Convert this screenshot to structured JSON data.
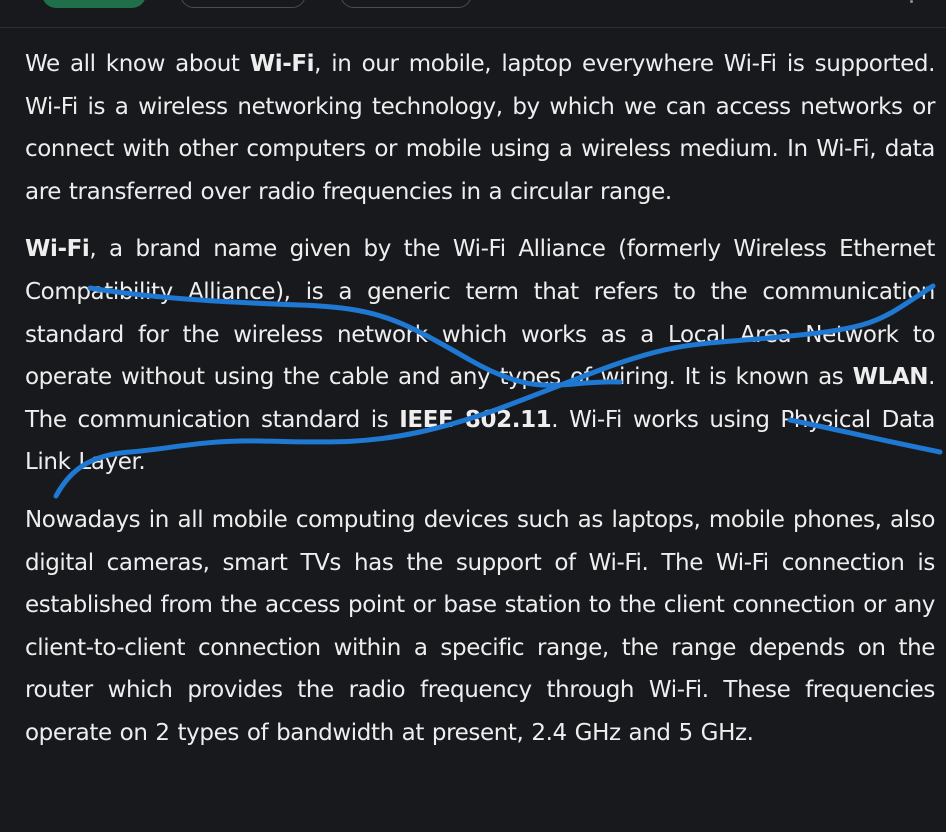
{
  "ink_color": "#1f78d1",
  "paragraphs": [
    {
      "parts": [
        {
          "text": "We all know about ",
          "bold": false
        },
        {
          "text": "Wi-Fi",
          "bold": true
        },
        {
          "text": ", in our mobile, laptop everywhere Wi-Fi is supported. Wi-Fi is a wireless networking technology, by which we can access networks or connect with other computers or mobile using a wireless medium. In Wi-Fi, data are transferred over radio frequencies in a circular range.",
          "bold": false
        }
      ]
    },
    {
      "crossed_out": true,
      "parts": [
        {
          "text": "Wi-Fi",
          "bold": true
        },
        {
          "text": ", a brand name given by the Wi-Fi Alliance (formerly Wireless Ethernet Compatibility Alliance), is a generic term that refers to the communication standard for the wireless network which works as a Local Area Network to operate without using the cable and any types of wiring. It is known as ",
          "bold": false
        },
        {
          "text": "WLAN",
          "bold": true
        },
        {
          "text": ". The communication standard is ",
          "bold": false
        },
        {
          "text": "IEEE 802.11",
          "bold": true
        },
        {
          "text": ". Wi-Fi works using Physical Data Link Layer.",
          "bold": false
        }
      ]
    },
    {
      "parts": [
        {
          "text": "Nowadays in all mobile computing devices such as laptops, mobile phones, also digital cameras, smart TVs has the support of Wi-Fi. The Wi-Fi connection is established from the access point or base station to the client connection or any client-to-client connection within a specific range, the range depends on the router which provides the radio frequency through Wi-Fi. These frequencies operate on 2 types of bandwidth at present, 2.4 GHz and 5 GHz.",
          "bold": false
        }
      ]
    }
  ]
}
